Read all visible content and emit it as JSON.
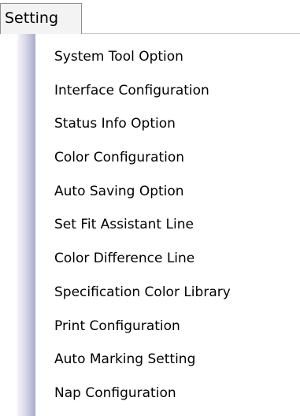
{
  "menubar": {
    "title": "Setting"
  },
  "menu": {
    "items": [
      {
        "label": "System Tool Option"
      },
      {
        "label": "Interface Configuration"
      },
      {
        "label": "Status Info Option"
      },
      {
        "label": "Color Configuration"
      },
      {
        "label": "Auto Saving Option"
      },
      {
        "label": "Set Fit Assistant Line"
      },
      {
        "label": "Color Difference Line"
      },
      {
        "label": "Specification Color Library"
      },
      {
        "label": "Print Configuration"
      },
      {
        "label": "Auto Marking Setting"
      },
      {
        "label": "Nap Configuration"
      }
    ]
  }
}
